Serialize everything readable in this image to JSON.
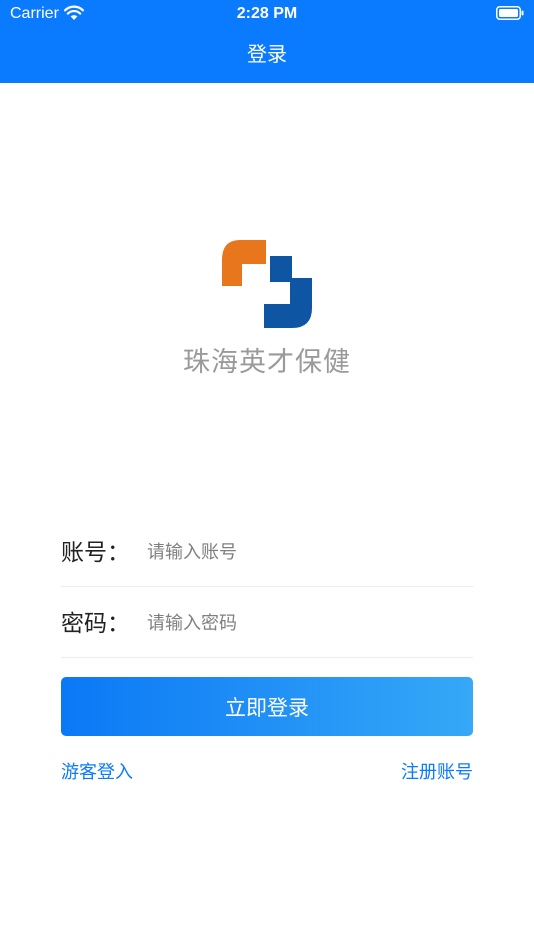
{
  "status_bar": {
    "carrier": "Carrier",
    "time": "2:28 PM",
    "wifi_icon": "wifi-icon",
    "battery_icon": "battery-icon"
  },
  "nav": {
    "title": "登录",
    "color": "#0a7afe"
  },
  "brand": {
    "logo_icon": "medical-cross-logo",
    "name": "珠海英才保健",
    "colors": {
      "orange": "#e8761c",
      "blue": "#0e55a3"
    }
  },
  "form": {
    "account": {
      "label": "账号：",
      "placeholder": "请输入账号",
      "value": ""
    },
    "password": {
      "label": "密码：",
      "placeholder": "请输入密码",
      "value": ""
    },
    "submit_label": "立即登录"
  },
  "links": {
    "guest": "游客登入",
    "register": "注册账号"
  }
}
